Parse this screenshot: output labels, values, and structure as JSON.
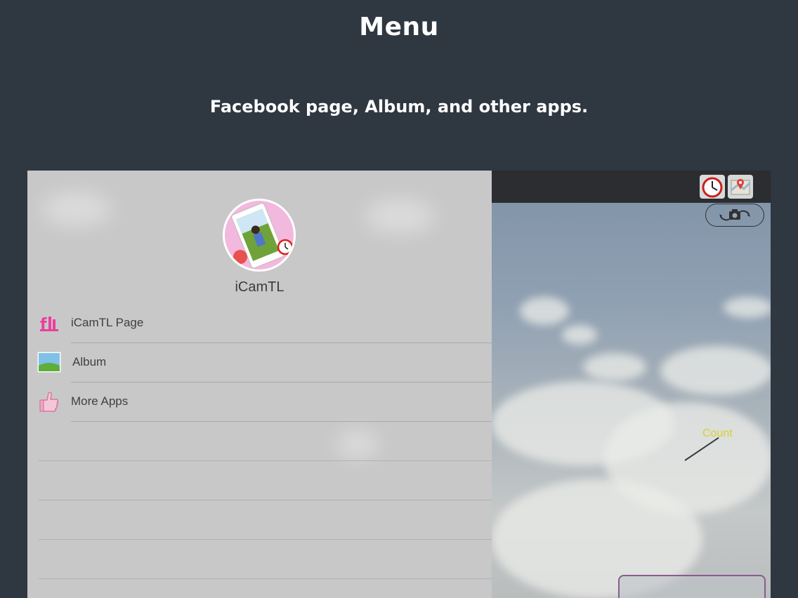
{
  "promo": {
    "title": "Menu",
    "subtitle": "Facebook page, Album, and other apps."
  },
  "drawer": {
    "app_name": "iCamTL",
    "items": [
      {
        "label": "iCamTL Page",
        "icon": "facebook-page-icon"
      },
      {
        "label": "Album",
        "icon": "album-photo-icon"
      },
      {
        "label": "More Apps",
        "icon": "thumbs-up-icon"
      }
    ]
  },
  "camera": {
    "overlay_label": "Count",
    "toolbar_icons": [
      "clock-icon",
      "map-pin-icon",
      "switch-camera-icon"
    ]
  },
  "colors": {
    "background": "#2f3741",
    "drawer": "#c8c8c9",
    "count_label": "#d7d22b"
  }
}
